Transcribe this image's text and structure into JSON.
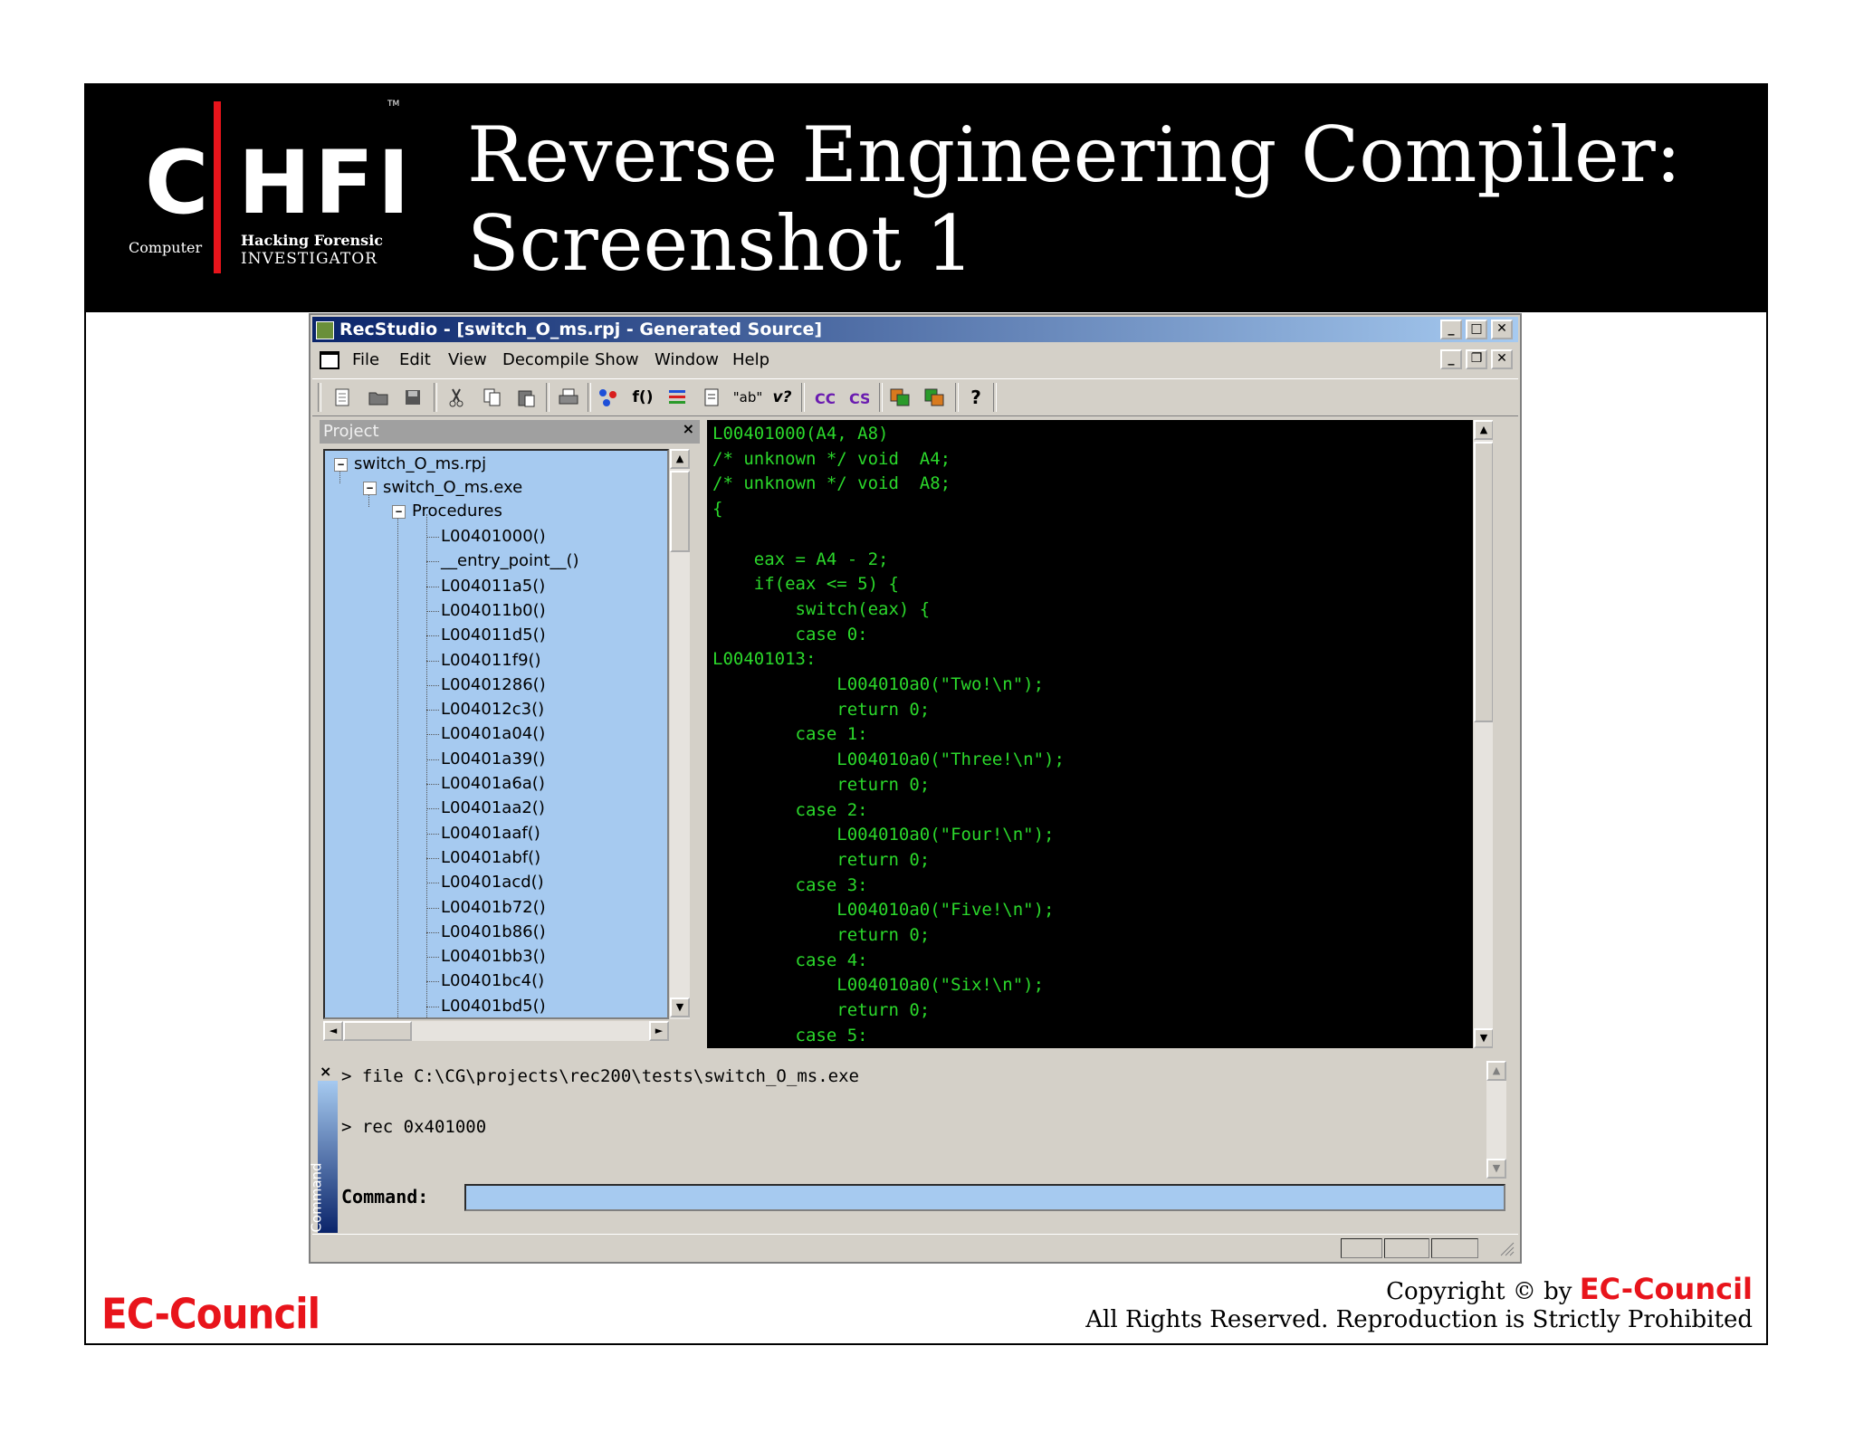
{
  "slide": {
    "title_line1": "Reverse Engineering Compiler:",
    "title_line2": "Screenshot 1"
  },
  "logo": {
    "letter_c": "C",
    "letters_hfi": "HFI",
    "tm": "TM",
    "computer": "Computer",
    "hacking_forensic": "Hacking Forensic",
    "investigator": "INVESTIGATOR"
  },
  "window": {
    "title": "RecStudio - [switch_O_ms.rpj - Generated Source]",
    "buttons": {
      "minimize": "_",
      "maximize": "□",
      "close": "✕",
      "mdi_minimize": "_",
      "mdi_restore": "❐",
      "mdi_close": "✕"
    },
    "menu": [
      "File",
      "Edit",
      "View",
      "Decompile",
      "Show",
      "Window",
      "Help"
    ],
    "toolbar_icons": [
      "new-icon",
      "open-folder-icon",
      "save-icon",
      "cut-icon",
      "copy-icon",
      "paste-icon",
      "print-icon",
      "graph-icon",
      "function-icon",
      "list-icon",
      "document-icon",
      "string-icon",
      "variable-icon",
      "c-source-icon",
      "s-source-icon",
      "export-icon",
      "import-icon",
      "help-icon"
    ],
    "toolbar_glyphs": {
      "function": "f()",
      "string": "\"ab\"",
      "variable": "v?",
      "help": "?"
    }
  },
  "project": {
    "header": "Project",
    "close": "×",
    "tree": {
      "root": "switch_O_ms.rpj",
      "exe": "switch_O_ms.exe",
      "procedures_label": "Procedures",
      "procedures": [
        "L00401000()",
        "__entry_point__()",
        "L004011a5()",
        "L004011b0()",
        "L004011d5()",
        "L004011f9()",
        "L00401286()",
        "L004012c3()",
        "L00401a04()",
        "L00401a39()",
        "L00401a6a()",
        "L00401aa2()",
        "L00401aaf()",
        "L00401abf()",
        "L00401acd()",
        "L00401b72()",
        "L00401b86()",
        "L00401bb3()",
        "L00401bc4()",
        "L00401bd5()"
      ]
    }
  },
  "code": {
    "lines": [
      "L00401000(A4, A8)",
      "/* unknown */ void  A4;",
      "/* unknown */ void  A8;",
      "{",
      "",
      "    eax = A4 - 2;",
      "    if(eax <= 5) {",
      "        switch(eax) {",
      "        case 0:",
      "L00401013:",
      "            L004010a0(\"Two!\\n\");",
      "            return 0;",
      "        case 1:",
      "            L004010a0(\"Three!\\n\");",
      "            return 0;",
      "        case 2:",
      "            L004010a0(\"Four!\\n\");",
      "            return 0;",
      "        case 3:",
      "            L004010a0(\"Five!\\n\");",
      "            return 0;",
      "        case 4:",
      "            L004010a0(\"Six!\\n\");",
      "            return 0;",
      "        case 5:"
    ]
  },
  "command": {
    "close": "×",
    "sidebar_label": "Command",
    "output": [
      "> file C:\\CG\\projects\\rec200\\tests\\switch_O_ms.exe",
      "> rec 0x401000"
    ],
    "label": "Command:",
    "input_value": ""
  },
  "footer": {
    "ec_council": "EC-Council",
    "copyright_prefix": "Copyright © by ",
    "copyright_brand": "EC-Council",
    "rights": "All Rights Reserved. Reproduction is Strictly Prohibited"
  },
  "colors": {
    "code_text": "#2bd82b",
    "code_background": "#000000",
    "tree_background": "#a6caf0",
    "titlebar_start": "#0a246a",
    "brand_red": "#e8141b"
  }
}
